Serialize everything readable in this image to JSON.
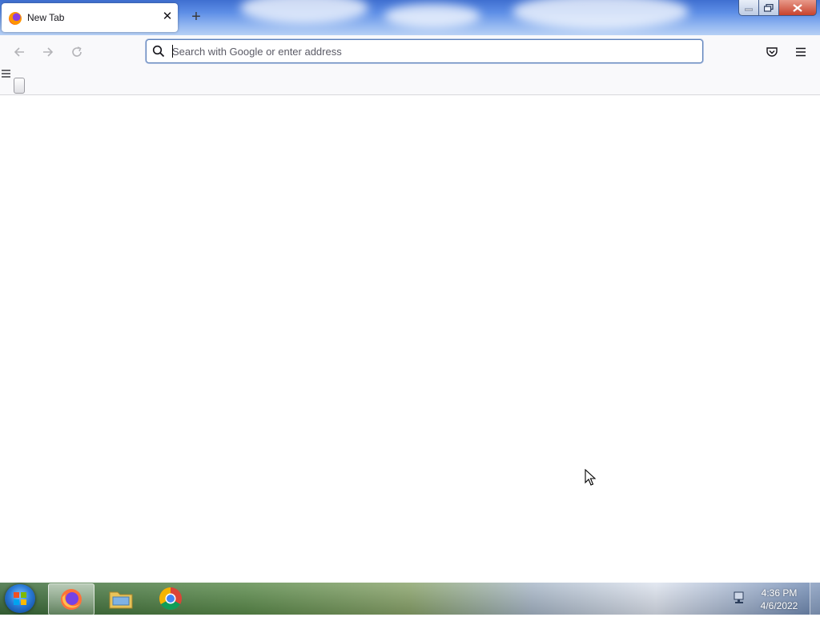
{
  "tab": {
    "title": "New Tab",
    "close_icon": "close-icon",
    "favicon": "firefox-icon"
  },
  "toolbar": {
    "new_tab_icon": "plus-icon",
    "back_icon": "arrow-left-icon",
    "forward_icon": "arrow-right-icon",
    "reload_icon": "reload-icon",
    "pocket_icon": "pocket-icon",
    "menu_icon": "hamburger-menu-icon"
  },
  "urlbar": {
    "placeholder": "Search with Google or enter address",
    "value": ""
  },
  "taskbar": {
    "apps": [
      {
        "name": "Firefox",
        "icon": "firefox-icon",
        "active": true
      },
      {
        "name": "Windows Explorer",
        "icon": "folder-icon",
        "active": false
      },
      {
        "name": "Google Chrome",
        "icon": "chrome-icon",
        "active": false
      }
    ],
    "clock": {
      "time": "4:36 PM",
      "date": "4/6/2022"
    }
  },
  "colors": {
    "accent": "#0060df",
    "urlbar_border": "#5b7fb8"
  }
}
